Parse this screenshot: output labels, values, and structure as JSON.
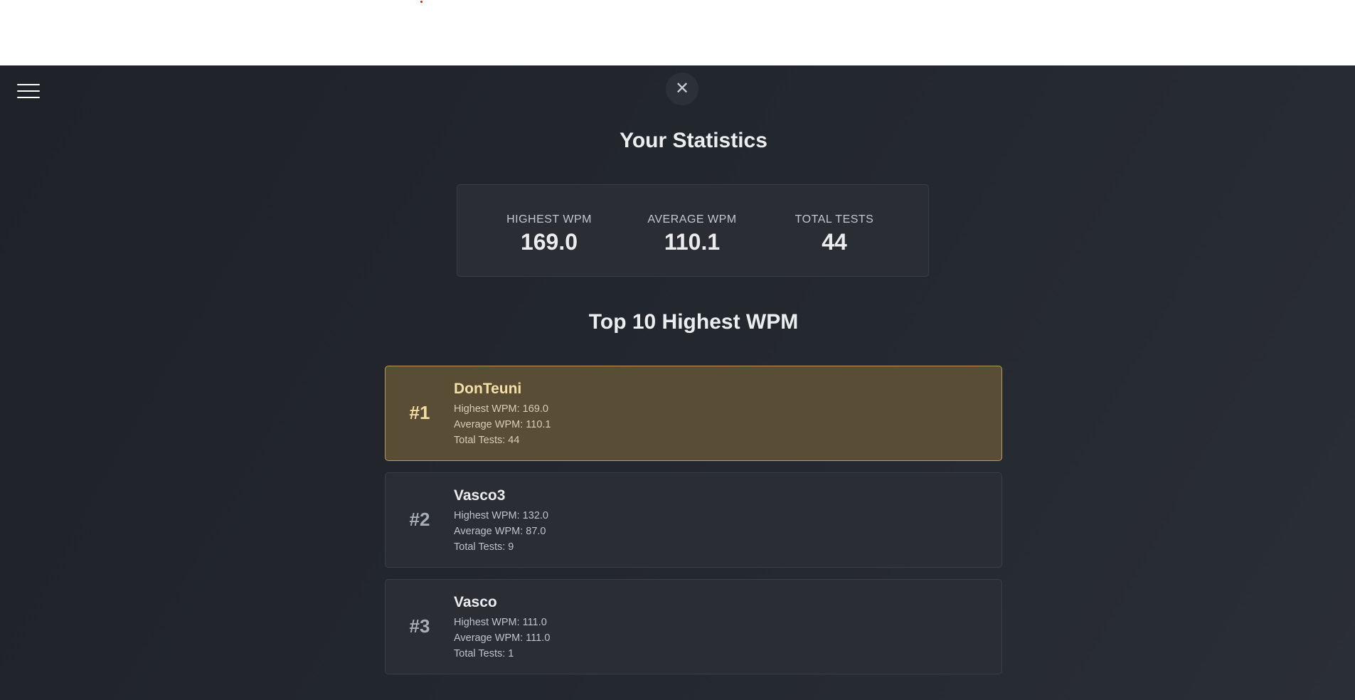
{
  "header": {
    "menu_icon": "hamburger-menu-icon",
    "close_icon": "close-icon",
    "close_glyph": "✕"
  },
  "stats": {
    "title": "Your Statistics",
    "items": [
      {
        "label": "HIGHEST WPM",
        "value": "169.0"
      },
      {
        "label": "AVERAGE WPM",
        "value": "110.1"
      },
      {
        "label": "TOTAL TESTS",
        "value": "44"
      }
    ]
  },
  "leaderboard": {
    "title": "Top 10 Highest WPM",
    "highlight_color": "#594d35",
    "entries": [
      {
        "rank": "#1",
        "name": "DonTeuni",
        "highest": "Highest WPM: 169.0",
        "average": "Average WPM: 110.1",
        "tests": "Total Tests: 44"
      },
      {
        "rank": "#2",
        "name": "Vasco3",
        "highest": "Highest WPM: 132.0",
        "average": "Average WPM: 87.0",
        "tests": "Total Tests: 9"
      },
      {
        "rank": "#3",
        "name": "Vasco",
        "highest": "Highest WPM: 111.0",
        "average": "Average WPM: 111.0",
        "tests": "Total Tests: 1"
      }
    ]
  }
}
